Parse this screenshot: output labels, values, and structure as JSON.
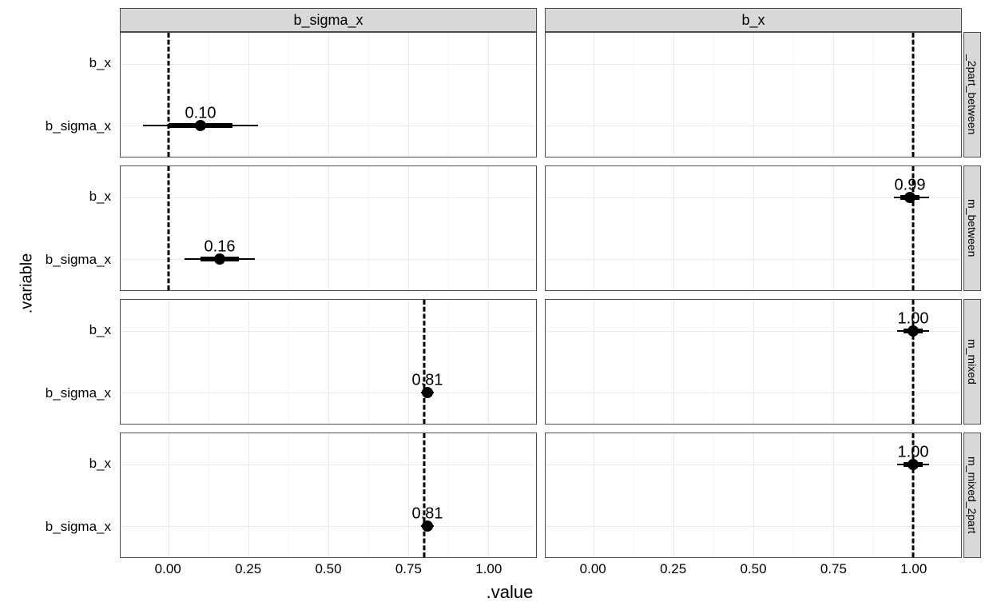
{
  "axis": {
    "y_title": ".variable",
    "x_title": ".value"
  },
  "col_strips": [
    "b_sigma_x",
    "b_x"
  ],
  "row_strips": [
    "_2part_between",
    "m_between",
    "m_mixed",
    "m_mixed_2part"
  ],
  "y_levels": [
    "b_x",
    "b_sigma_x"
  ],
  "x_ticks": [
    "0.00",
    "0.25",
    "0.50",
    "0.75",
    "1.00"
  ],
  "chart_data": {
    "type": "scatter",
    "title": "",
    "xlabel": ".value",
    "ylabel": ".variable",
    "facets": {
      "cols": [
        "b_sigma_x",
        "b_x"
      ],
      "rows": [
        "_2part_between",
        "m_between",
        "m_mixed",
        "m_mixed_2part"
      ]
    },
    "x_range": [
      -0.15,
      1.15
    ],
    "x_ticks": [
      0.0,
      0.25,
      0.5,
      0.75,
      1.0
    ],
    "y_categories": [
      "b_x",
      "b_sigma_x"
    ],
    "reference_lines": {
      "b_sigma_x": {
        "_2part_between": 0.0,
        "m_between": 0.0,
        "m_mixed": 0.8,
        "m_mixed_2part": 0.8
      },
      "b_x": {
        "_2part_between": 1.0,
        "m_between": 1.0,
        "m_mixed": 1.0,
        "m_mixed_2part": 1.0
      }
    },
    "series": [
      {
        "row": "_2part_between",
        "col": "b_sigma_x",
        "y": "b_sigma_x",
        "estimate": 0.1,
        "ci90": [
          -0.08,
          0.28
        ],
        "ci50": [
          0.0,
          0.2
        ],
        "label": "0.10"
      },
      {
        "row": "m_between",
        "col": "b_sigma_x",
        "y": "b_sigma_x",
        "estimate": 0.16,
        "ci90": [
          0.05,
          0.27
        ],
        "ci50": [
          0.1,
          0.22
        ],
        "label": "0.16"
      },
      {
        "row": "m_between",
        "col": "b_x",
        "y": "b_x",
        "estimate": 0.99,
        "ci90": [
          0.94,
          1.05
        ],
        "ci50": [
          0.96,
          1.02
        ],
        "label": "0.99"
      },
      {
        "row": "m_mixed",
        "col": "b_sigma_x",
        "y": "b_sigma_x",
        "estimate": 0.81,
        "ci90": [
          0.79,
          0.83
        ],
        "ci50": [
          0.8,
          0.82
        ],
        "label": "0.81"
      },
      {
        "row": "m_mixed",
        "col": "b_x",
        "y": "b_x",
        "estimate": 1.0,
        "ci90": [
          0.95,
          1.05
        ],
        "ci50": [
          0.97,
          1.03
        ],
        "label": "1.00"
      },
      {
        "row": "m_mixed_2part",
        "col": "b_sigma_x",
        "y": "b_sigma_x",
        "estimate": 0.81,
        "ci90": [
          0.79,
          0.83
        ],
        "ci50": [
          0.8,
          0.82
        ],
        "label": "0.81"
      },
      {
        "row": "m_mixed_2part",
        "col": "b_x",
        "y": "b_x",
        "estimate": 1.0,
        "ci90": [
          0.95,
          1.05
        ],
        "ci50": [
          0.97,
          1.03
        ],
        "label": "1.00"
      }
    ]
  }
}
